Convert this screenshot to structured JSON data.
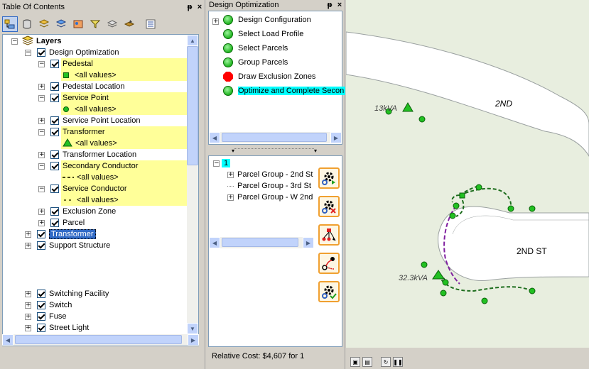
{
  "toc": {
    "title": "Table Of Contents",
    "pin": "ᵽ",
    "close": "×",
    "tree": {
      "layers_label": "Layers",
      "design_optimization": "Design Optimization",
      "pedestal": "Pedestal",
      "all_values": "<all values>",
      "pedestal_location": "Pedestal Location",
      "service_point": "Service Point",
      "service_point_location": "Service Point Location",
      "transformer": "Transformer",
      "transformer_location": "Transformer Location",
      "secondary_conductor": "Secondary Conductor",
      "service_conductor": "Service Conductor",
      "exclusion_zone": "Exclusion Zone",
      "parcel": "Parcel",
      "transformer_top": "Transformer",
      "support_structure": "Support Structure",
      "switching_facility": "Switching Facility",
      "switch": "Switch",
      "fuse": "Fuse",
      "street_light": "Street Light"
    }
  },
  "design_opt": {
    "title": "Design Optimization",
    "steps": [
      "Design Configuration",
      "Select Load Profile",
      "Select Parcels",
      "Group Parcels",
      "Draw Exclusion Zones",
      "Optimize and Complete Secon"
    ],
    "group_root": "1",
    "groups": [
      "Parcel Group - 2nd St",
      "Parcel Group - 3rd St",
      "Parcel Group - W 2nd"
    ],
    "relative_cost": "Relative Cost: $4,607 for 1"
  },
  "map": {
    "labels": {
      "street_2nd": "2ND",
      "street_2nd_st": "2ND ST",
      "kva_1": "13kVA",
      "kva_2": "32.3kVA"
    }
  },
  "colors": {
    "highlight": "#ffff99",
    "selection": "#316ac5",
    "current_step": "#00ffff",
    "road": "#ffffff",
    "parcel_bg": "#e8eedf",
    "conductor": "#1e6e1e"
  }
}
